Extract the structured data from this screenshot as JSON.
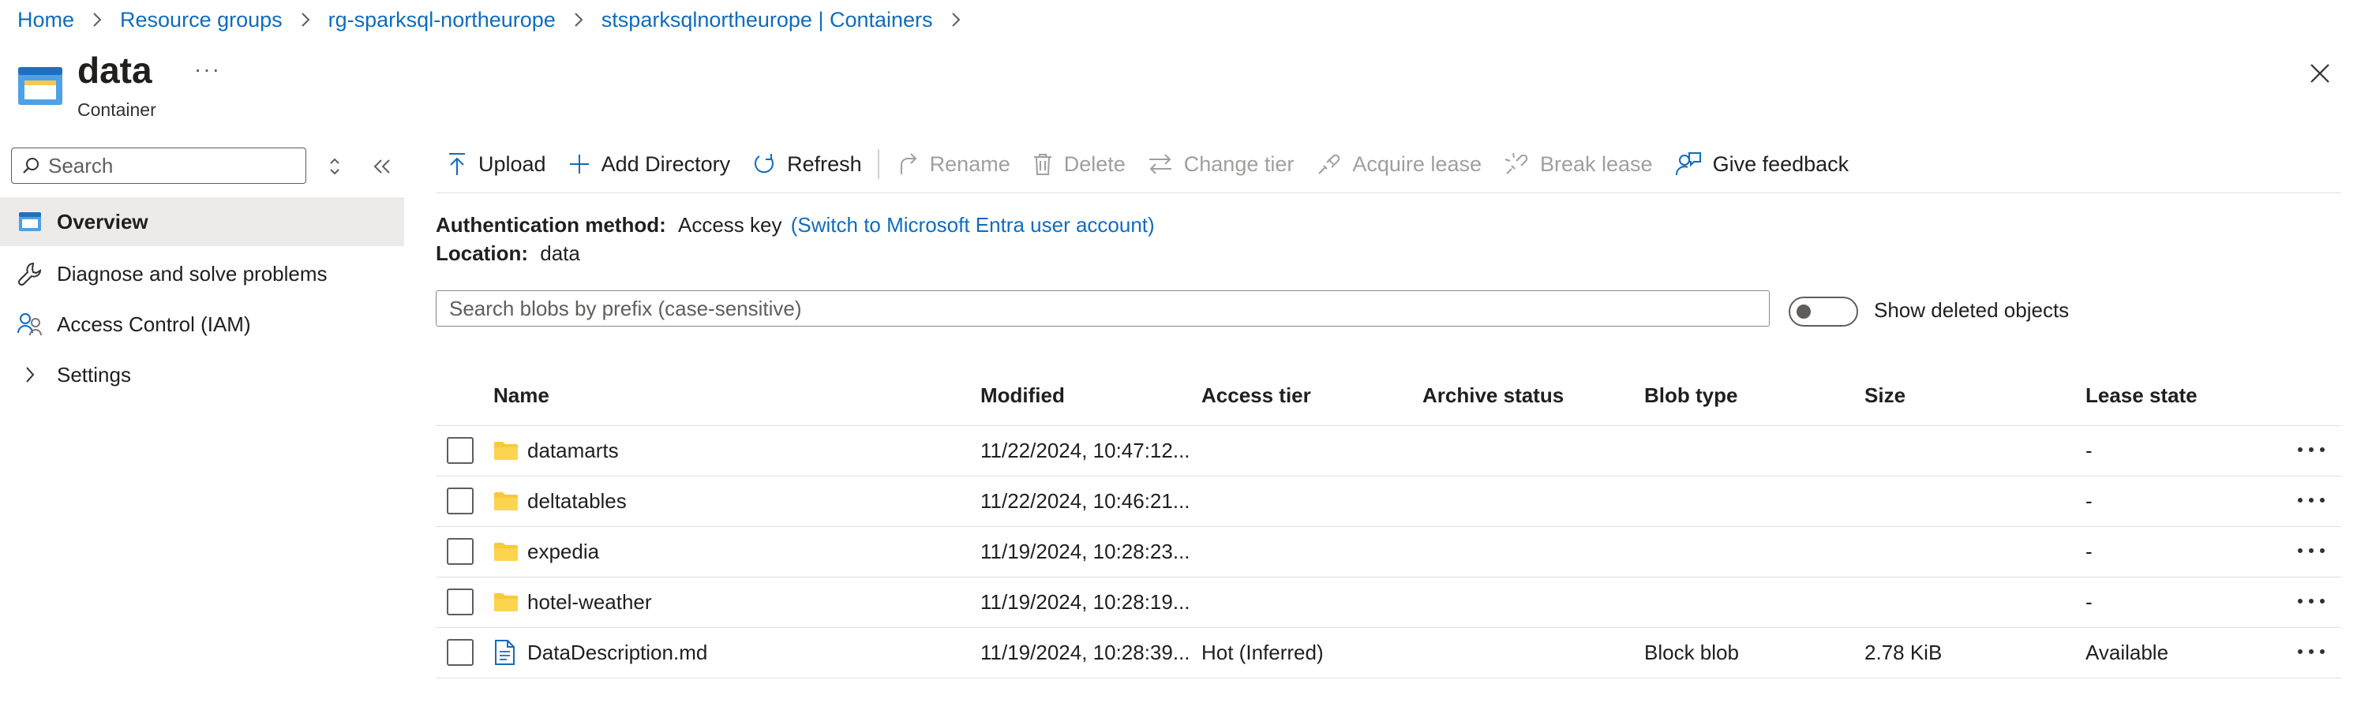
{
  "breadcrumb": [
    "Home",
    "Resource groups",
    "rg-sparksql-northeurope",
    "stsparksqlnortheurope | Containers"
  ],
  "header": {
    "title": "data",
    "subtitle": "Container",
    "more": "···"
  },
  "nav": {
    "search_placeholder": "Search",
    "items": [
      {
        "label": "Overview",
        "icon": "container-icon",
        "active": true
      },
      {
        "label": "Diagnose and solve problems",
        "icon": "wrench-icon"
      },
      {
        "label": "Access Control (IAM)",
        "icon": "people-icon"
      },
      {
        "label": "Settings",
        "icon": "chevron-right-icon"
      }
    ]
  },
  "toolbar": {
    "upload": "Upload",
    "add_directory": "Add Directory",
    "refresh": "Refresh",
    "rename": "Rename",
    "delete": "Delete",
    "change_tier": "Change tier",
    "acquire_lease": "Acquire lease",
    "break_lease": "Break lease",
    "give_feedback": "Give feedback"
  },
  "info": {
    "auth_label": "Authentication method:",
    "auth_value": "Access key",
    "auth_link": "(Switch to Microsoft Entra user account)",
    "location_label": "Location:",
    "location_value": "data"
  },
  "blob_search": {
    "placeholder": "Search blobs by prefix (case-sensitive)"
  },
  "show_deleted": {
    "label": "Show deleted objects",
    "on": false
  },
  "table": {
    "columns": [
      "Name",
      "Modified",
      "Access tier",
      "Archive status",
      "Blob type",
      "Size",
      "Lease state"
    ],
    "rows": [
      {
        "type": "folder",
        "name": "datamarts",
        "modified": "11/22/2024, 10:47:12...",
        "tier": "",
        "archive": "",
        "blob_type": "",
        "size": "",
        "lease": "-"
      },
      {
        "type": "folder",
        "name": "deltatables",
        "modified": "11/22/2024, 10:46:21...",
        "tier": "",
        "archive": "",
        "blob_type": "",
        "size": "",
        "lease": "-"
      },
      {
        "type": "folder",
        "name": "expedia",
        "modified": "11/19/2024, 10:28:23...",
        "tier": "",
        "archive": "",
        "blob_type": "",
        "size": "",
        "lease": "-"
      },
      {
        "type": "folder",
        "name": "hotel-weather",
        "modified": "11/19/2024, 10:28:19...",
        "tier": "",
        "archive": "",
        "blob_type": "",
        "size": "",
        "lease": "-"
      },
      {
        "type": "file",
        "name": "DataDescription.md",
        "modified": "11/19/2024, 10:28:39...",
        "tier": "Hot (Inferred)",
        "archive": "",
        "blob_type": "Block blob",
        "size": "2.78 KiB",
        "lease": "Available"
      }
    ]
  },
  "colors": {
    "accent": "#0f6cbd",
    "folder": "#f8c93a",
    "text": "#201f1e",
    "muted": "#605e5c",
    "disabled": "#a19f9d",
    "nav_active": "#edebe9"
  }
}
